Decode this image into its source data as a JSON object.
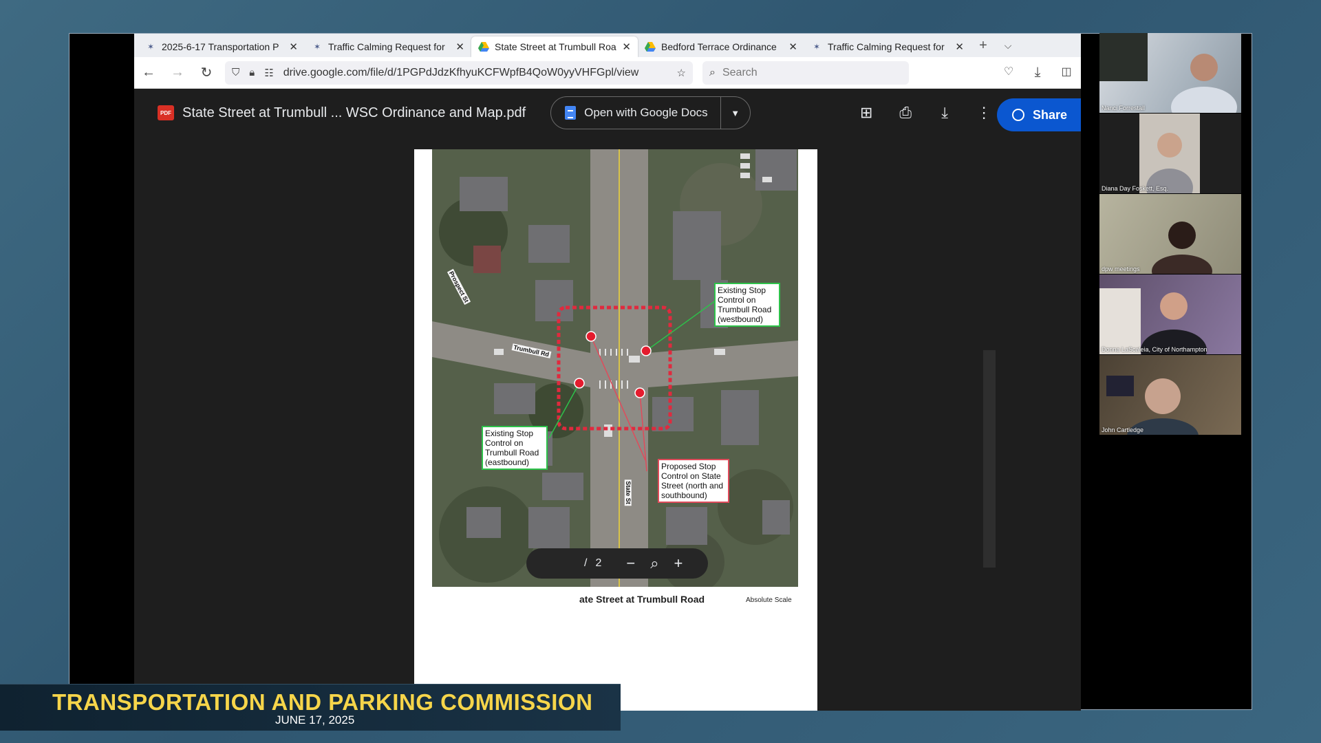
{
  "browser": {
    "tabs": [
      {
        "title": "2025-6-17 Transportation P",
        "active": false,
        "icon": "zoom-icon"
      },
      {
        "title": "Traffic Calming Request for",
        "active": false,
        "icon": "zoom-icon"
      },
      {
        "title": "State Street at Trumbull Roa",
        "active": true,
        "icon": "google-drive-icon"
      },
      {
        "title": "Bedford Terrace Ordinance",
        "active": false,
        "icon": "google-drive-icon"
      },
      {
        "title": "Traffic Calming Request for",
        "active": false,
        "icon": "zoom-icon"
      }
    ],
    "url": "drive.google.com/file/d/1PGPdJdzKfhyuKCFWpfB4QoW0yyVHFGpl/view",
    "search_placeholder": "Search"
  },
  "drive": {
    "file_icon_label": "PDF",
    "filename": "State Street at Trumbull ... WSC Ordinance and Map.pdf",
    "open_with_label": "Open with Google Docs",
    "share_label": "Share"
  },
  "map": {
    "callouts": {
      "westbound": "Existing Stop Control on Trumbull Road (westbound)",
      "eastbound": "Existing Stop Control on Trumbull Road (eastbound)",
      "proposed": "Proposed Stop Control on State Street (north and southbound)"
    },
    "streets": {
      "prospect": "Prospect St",
      "trumbull": "Trumbull Rd",
      "state": "State St"
    },
    "footer_title": "ate Street at Trumbull Road",
    "scale_label": "Absolute Scale"
  },
  "pager": {
    "current": "",
    "separator": "/",
    "total": "2"
  },
  "participants": [
    {
      "name": "Nanci Forrestall"
    },
    {
      "name": "Diana Day Foskett, Esq."
    },
    {
      "name": "dpw meetings"
    },
    {
      "name": "Donna LaScaleia, City of Northampton"
    },
    {
      "name": "John Cartledge"
    }
  ],
  "broadcast": {
    "title": "TRANSPORTATION AND PARKING COMMISSION",
    "date": "JUNE 17, 2025"
  },
  "colors": {
    "callout_existing": "#2dc24a",
    "callout_proposed": "#e04b5b",
    "share_blue": "#0b57d0",
    "lower_third_title": "#f6d54a"
  }
}
